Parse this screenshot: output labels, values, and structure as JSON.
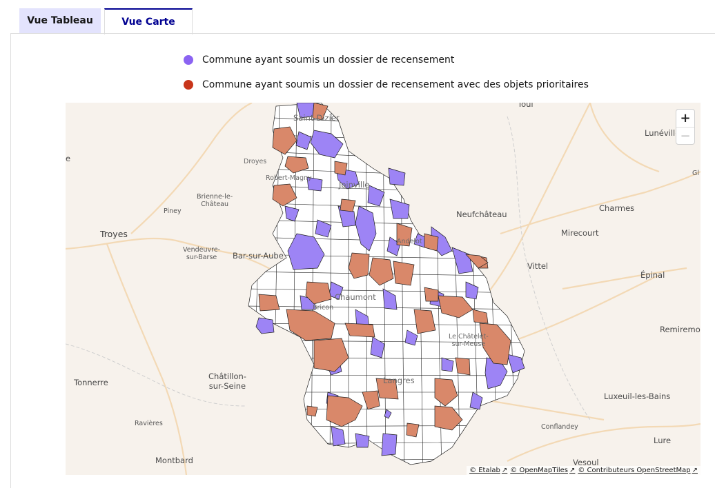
{
  "tabs": [
    {
      "label": "Vue Tableau",
      "active": false
    },
    {
      "label": "Vue Carte",
      "active": true
    }
  ],
  "legend": [
    {
      "label": "Commune ayant soumis un dossier de recensement",
      "color": "#8b63f2"
    },
    {
      "label": "Commune ayant soumis un dossier de recensement avec des objets prioritaires",
      "color": "#c8351a"
    }
  ],
  "colors": {
    "submitted": "#9d84f5",
    "priority": "#d9886a",
    "accent": "#000091",
    "map_background": "#f7f2ec"
  },
  "map": {
    "zoom_in": "+",
    "zoom_out": "−",
    "places": {
      "troyes": "Troyes",
      "brienne": "Brienne-le-\nChâteau",
      "piney": "Piney",
      "vendeuvre": "Vendeuvre-\nsur-Barse",
      "bar_sur_aube": "Bar-sur-Aube",
      "tonnerre": "Tonnerre",
      "chatillon": "Châtillon-\nsur-Seine",
      "ravieres": "Ravières",
      "montbard": "Montbard",
      "neufchateau": "Neufchâteau",
      "charmes": "Charmes",
      "mirecourt": "Mirecourt",
      "vittel": "Vittel",
      "epinal": "Épinal",
      "luneville": "Lunéville",
      "toul": "Toul",
      "remiremont": "Remiremo",
      "luxeuil": "Luxeuil-les-Bains",
      "conflandey": "Conflandey",
      "lure": "Lure",
      "vesoul": "Vesoul",
      "saint_dizier": "Saint-Dizier",
      "droyes": "Droyes",
      "robert_magny": "Robert-Magny",
      "joinville": "Joinville",
      "chaumont": "Chaumont",
      "langres": "Langres",
      "chatelet": "Le Châtelet-\nsur-Meuse",
      "andelot": "Andelot",
      "bricon": "Bricon",
      "edge_e": "e",
      "edge_gl": "Gl"
    },
    "attribution": [
      {
        "label": "© Etalab"
      },
      {
        "label": "© OpenMapTiles"
      },
      {
        "label": "© Contributeurs OpenStreetMap"
      }
    ]
  }
}
